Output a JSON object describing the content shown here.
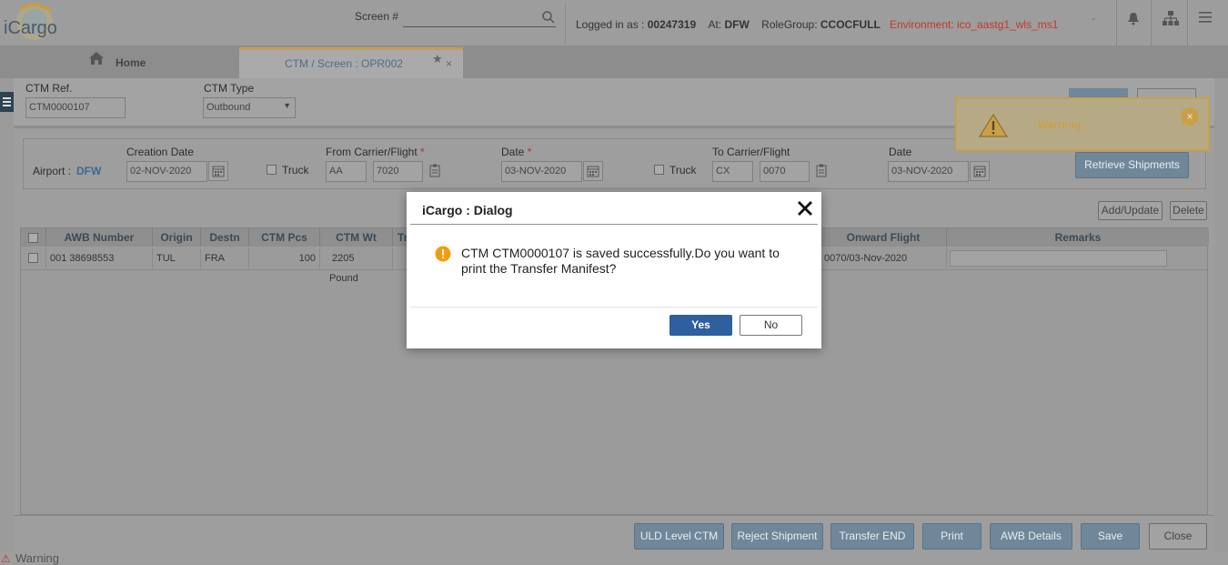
{
  "header": {
    "logo_text": "iCargo",
    "screen_label": "Screen #",
    "logged_in_label": "Logged in as : ",
    "user_id": "00247319",
    "at_label": "At: ",
    "at_value": "DFW",
    "rolegroup_label": "RoleGroup: ",
    "rolegroup_value": "CCOCFULL",
    "environment": "Environment: ico_aastg1_wls_ms1"
  },
  "tabs": [
    {
      "label": "Home"
    },
    {
      "label": "CTM / Screen : OPR002"
    }
  ],
  "form": {
    "ctm_ref_label": "CTM Ref.",
    "ctm_ref_value": "CTM0000107",
    "ctm_type_label": "CTM Type",
    "ctm_type_value": "Outbound",
    "airport_label": "Airport : ",
    "airport_value": "DFW",
    "creation_date_label": "Creation Date",
    "creation_date_value": "02-NOV-2020",
    "truck_label": "Truck",
    "from_carrier_label": "From Carrier/Flight",
    "from_carrier_value": "AA",
    "from_flight_value": "7020",
    "date_label": "Date",
    "from_date_value": "03-NOV-2020",
    "to_carrier_label": "To Carrier/Flight",
    "to_carrier_value": "CX",
    "to_flight_value": "0070",
    "to_date_label": "Date",
    "to_date_value": "03-NOV-2020",
    "required_mark": "*",
    "retrieve_button": "Retrieve Shipments",
    "add_update_button": "Add/Update",
    "delete_button": "Delete"
  },
  "table": {
    "columns": [
      "AWB Number",
      "Origin",
      "Destn",
      "CTM Pcs",
      "CTM Wt",
      "Tr",
      "Onward Flight",
      "Remarks"
    ],
    "rows": [
      {
        "awb": "001 38698553",
        "origin": "TUL",
        "destn": "FRA",
        "pcs": "100",
        "wt": "2205",
        "unit": "Pound",
        "onward": "0070/03-Nov-2020",
        "remarks": ""
      }
    ]
  },
  "footer": {
    "buttons": [
      "ULD Level CTM",
      "Reject Shipment",
      "Transfer END",
      "Print",
      "AWB Details",
      "Save",
      "Close"
    ]
  },
  "status": {
    "text": "Warning"
  },
  "toast": {
    "text": "Warning"
  },
  "dialog": {
    "title": "iCargo : Dialog",
    "message": "CTM CTM0000107 is saved successfully.Do you want to print the Transfer Manifest?",
    "yes_label": "Yes",
    "no_label": "No"
  },
  "colors": {
    "environment": "#c0392b",
    "primary_button": "#2f5f9e",
    "toast_border": "#c9a04a"
  }
}
